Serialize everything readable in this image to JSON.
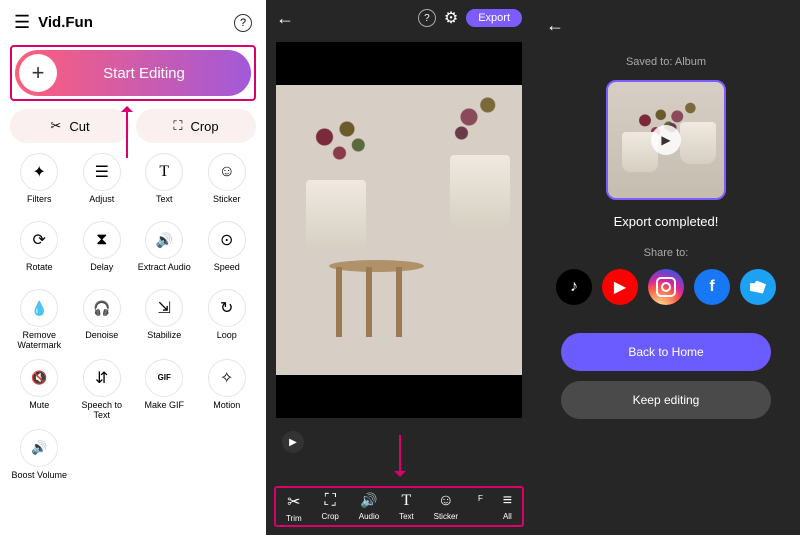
{
  "panel1": {
    "app_name": "Vid.Fun",
    "start_label": "Start Editing",
    "cut_label": "Cut",
    "crop_label": "Crop",
    "tools": [
      {
        "label": "Filters",
        "icon": "star"
      },
      {
        "label": "Adjust",
        "icon": "adjust"
      },
      {
        "label": "Text",
        "icon": "text"
      },
      {
        "label": "Sticker",
        "icon": "smiley"
      },
      {
        "label": "Rotate",
        "icon": "rotate"
      },
      {
        "label": "Delay",
        "icon": "delay"
      },
      {
        "label": "Extract Audio",
        "icon": "extract"
      },
      {
        "label": "Speed",
        "icon": "speed"
      },
      {
        "label": "Remove Watermark",
        "icon": "water"
      },
      {
        "label": "Denoise",
        "icon": "denoise"
      },
      {
        "label": "Stabilize",
        "icon": "stabilize"
      },
      {
        "label": "Loop",
        "icon": "loop"
      },
      {
        "label": "Mute",
        "icon": "mute"
      },
      {
        "label": "Speech to Text",
        "icon": "speech"
      },
      {
        "label": "Make GIF",
        "icon": "gif"
      },
      {
        "label": "Motion",
        "icon": "motion"
      },
      {
        "label": "Boost Volume",
        "icon": "boost"
      }
    ]
  },
  "panel2": {
    "export_label": "Export",
    "toolbar": [
      {
        "label": "Trim",
        "icon": "trim"
      },
      {
        "label": "Crop",
        "icon": "crop"
      },
      {
        "label": "Audio",
        "icon": "audio"
      },
      {
        "label": "Text",
        "icon": "text"
      },
      {
        "label": "Sticker",
        "icon": "smiley"
      },
      {
        "label": "F",
        "icon": ""
      },
      {
        "label": "All",
        "icon": "all"
      }
    ]
  },
  "panel3": {
    "saved_to": "Saved to: Album",
    "completed": "Export completed!",
    "share_to": "Share to:",
    "back_home": "Back to Home",
    "keep_editing": "Keep editing",
    "share_targets": [
      "tiktok",
      "youtube",
      "instagram",
      "facebook",
      "twitter"
    ]
  }
}
